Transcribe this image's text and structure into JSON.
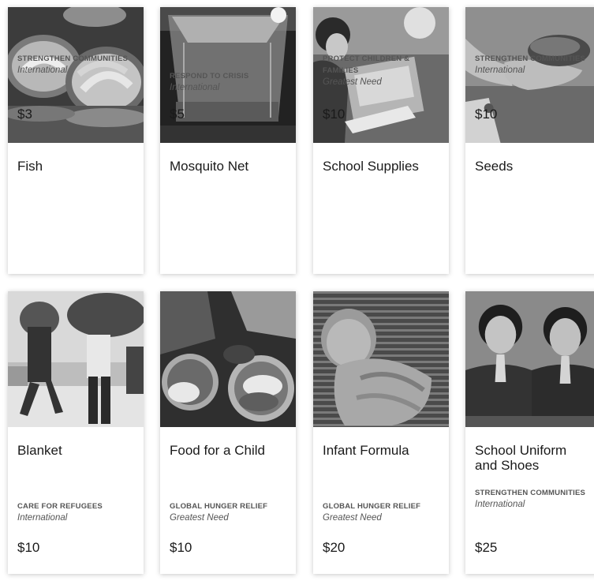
{
  "products": [
    {
      "title": "Fish",
      "category": "STRENGTHEN COMMUNITIES",
      "scope": "International",
      "price": "$3",
      "image_icon": "fish-baskets-image"
    },
    {
      "title": "Mosquito Net",
      "category": "RESPOND TO CRISIS",
      "scope": "International",
      "price": "$5",
      "image_icon": "mosquito-net-image"
    },
    {
      "title": "School Supplies",
      "category": "PROTECT CHILDREN & FAMILIES",
      "scope": "Greatest Need",
      "price": "$10",
      "image_icon": "school-supplies-image"
    },
    {
      "title": "Seeds",
      "category": "STRENGTHEN COMMUNITIES",
      "scope": "International",
      "price": "$10",
      "image_icon": "seeds-in-hand-image"
    },
    {
      "title": "Blanket",
      "category": "CARE FOR REFUGEES",
      "scope": "International",
      "price": "$10",
      "image_icon": "refugees-blankets-image"
    },
    {
      "title": "Food for a Child",
      "category": "GLOBAL HUNGER RELIEF",
      "scope": "Greatest Need",
      "price": "$10",
      "image_icon": "food-bowls-image"
    },
    {
      "title": "Infant Formula",
      "category": "GLOBAL HUNGER RELIEF",
      "scope": "Greatest Need",
      "price": "$20",
      "image_icon": "sleeping-infant-image"
    },
    {
      "title": "School Uniform and Shoes",
      "category": "STRENGTHEN COMMUNITIES",
      "scope": "International",
      "price": "$25",
      "image_icon": "schoolgirls-praying-image"
    }
  ]
}
